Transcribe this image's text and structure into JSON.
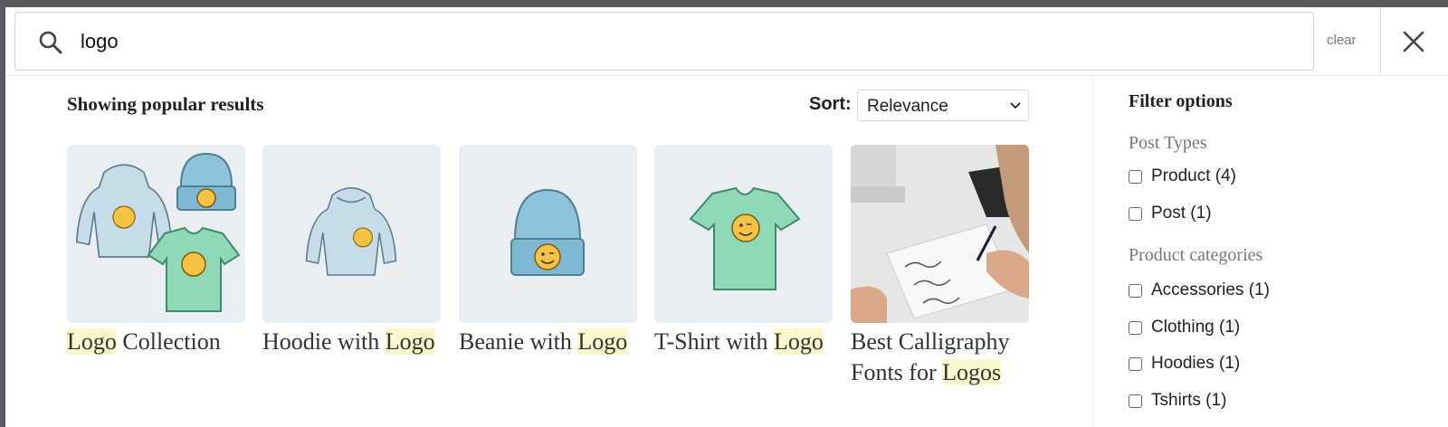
{
  "search": {
    "value": "logo",
    "clear_label": "clear"
  },
  "results": {
    "heading": "Showing popular results",
    "sort": {
      "label": "Sort:",
      "selected": "Relevance"
    },
    "items": [
      {
        "title_parts": [
          {
            "text": "Logo",
            "hl": true
          },
          {
            "text": " Collection",
            "hl": false
          }
        ],
        "image": "logo-collection"
      },
      {
        "title_parts": [
          {
            "text": "Hoodie with ",
            "hl": false
          },
          {
            "text": "Logo",
            "hl": true
          }
        ],
        "image": "hoodie"
      },
      {
        "title_parts": [
          {
            "text": "Beanie with ",
            "hl": false
          },
          {
            "text": "Logo",
            "hl": true
          }
        ],
        "image": "beanie"
      },
      {
        "title_parts": [
          {
            "text": "T-Shirt with ",
            "hl": false
          },
          {
            "text": "Logo",
            "hl": true
          }
        ],
        "image": "tshirt"
      },
      {
        "title_parts": [
          {
            "text": "Best Calligraphy Fonts for ",
            "hl": false
          },
          {
            "text": "Logos",
            "hl": true
          }
        ],
        "image": "calligraphy-photo"
      }
    ]
  },
  "filters": {
    "title": "Filter options",
    "groups": [
      {
        "title": "Post Types",
        "options": [
          {
            "label": "Product (4)"
          },
          {
            "label": "Post (1)"
          }
        ]
      },
      {
        "title": "Product categories",
        "options": [
          {
            "label": "Accessories (1)"
          },
          {
            "label": "Clothing (1)"
          },
          {
            "label": "Hoodies (1)"
          },
          {
            "label": "Tshirts (1)"
          }
        ]
      }
    ]
  },
  "colors": {
    "highlight": "#fdf8cc",
    "thumb_bg": "#e8eef1",
    "hoodie": "#c6dde8",
    "beanie": "#8ec3dc",
    "tshirt": "#8fd9b6",
    "emoji": "#f7c244"
  },
  "icons": {
    "search": "search-icon",
    "close": "close-icon",
    "chevron": "chevron-down-icon"
  }
}
